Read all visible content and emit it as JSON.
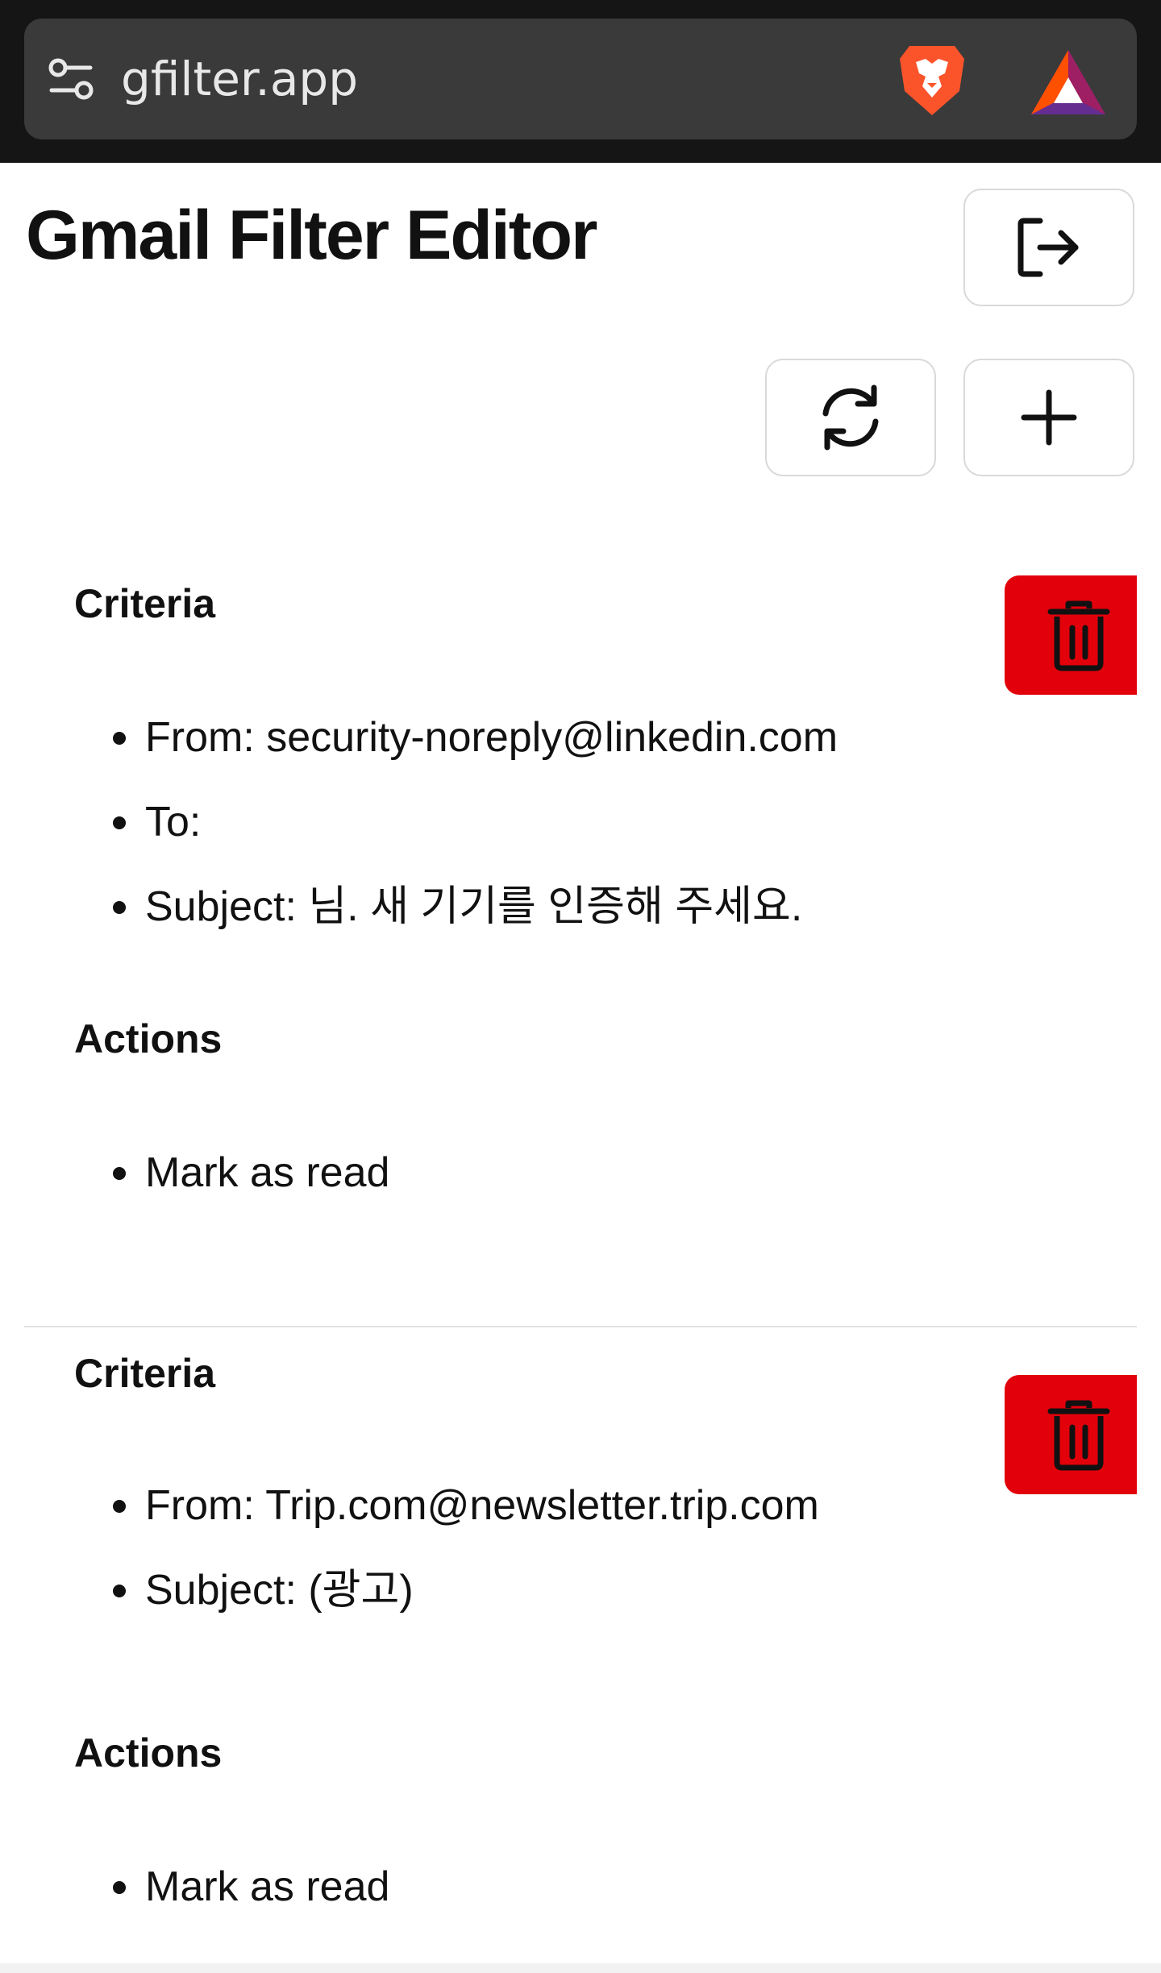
{
  "browser": {
    "url": "gfilter.app",
    "icons": [
      "tune-icon",
      "brave-lion-icon",
      "bat-rewards-icon"
    ]
  },
  "header": {
    "title": "Gmail Filter Editor",
    "buttons": [
      "logout-icon",
      "refresh-icon",
      "plus-icon"
    ]
  },
  "filters": [
    {
      "criteria_heading": "Criteria",
      "criteria": [
        "From: security-noreply@linkedin.com",
        "To:",
        "Subject: 님. 새 기기를 인증해 주세요."
      ],
      "actions_heading": "Actions",
      "actions": [
        "Mark as read"
      ]
    },
    {
      "criteria_heading": "Criteria",
      "criteria": [
        "From: Trip.com@newsletter.trip.com",
        "Subject: (광고)"
      ],
      "actions_heading": "Actions",
      "actions": [
        "Mark as read"
      ]
    }
  ],
  "colors": {
    "delete_button": "#e2000b",
    "browser_bar": "#151515",
    "url_box": "#3a3a3a",
    "brave_orange": "#fb542b",
    "bat_purple": "#662d91"
  }
}
